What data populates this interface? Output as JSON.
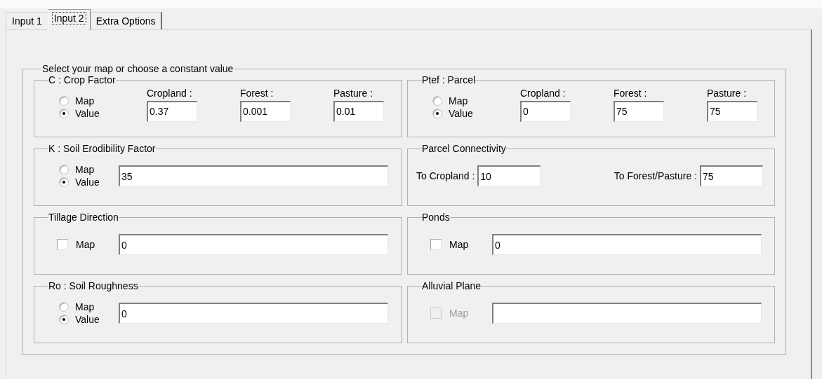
{
  "tabs": [
    {
      "label": "Input 1",
      "selected": false
    },
    {
      "label": "Input 2",
      "selected": true
    },
    {
      "label": "Extra Options",
      "selected": false
    }
  ],
  "outer_group": {
    "title": "Select your map or choose a constant value"
  },
  "groups": [
    {
      "title": "C : Crop Factor",
      "kind": "radio_fields",
      "options": [
        {
          "label": "Map",
          "selected": false
        },
        {
          "label": "Value",
          "selected": true
        }
      ],
      "fields": [
        {
          "label": "Cropland :",
          "value": "0.37"
        },
        {
          "label": "Forest :",
          "value": "0.001"
        },
        {
          "label": "Pasture :",
          "value": "0.01"
        }
      ]
    },
    {
      "title": "Ptef : Parcel",
      "kind": "radio_fields",
      "options": [
        {
          "label": "Map",
          "selected": false
        },
        {
          "label": "Value",
          "selected": true
        }
      ],
      "fields": [
        {
          "label": "Cropland :",
          "value": "0"
        },
        {
          "label": "Forest :",
          "value": "75"
        },
        {
          "label": "Pasture :",
          "value": "75"
        }
      ]
    },
    {
      "title": "K : Soil Erodibility Factor",
      "kind": "radio_single",
      "options": [
        {
          "label": "Map",
          "selected": false
        },
        {
          "label": "Value",
          "selected": true
        }
      ],
      "fields": [
        {
          "value": "35"
        }
      ]
    },
    {
      "title": "Parcel Connectivity",
      "kind": "inline_fields",
      "fields": [
        {
          "label": "To Cropland :",
          "value": "10"
        },
        {
          "label": "To Forest/Pasture :",
          "value": "75"
        }
      ]
    },
    {
      "title": "Tillage Direction",
      "kind": "check_single",
      "check": {
        "label": "Map",
        "checked": false,
        "disabled": false
      },
      "fields": [
        {
          "value": "0"
        }
      ]
    },
    {
      "title": "Ponds",
      "kind": "check_single",
      "check": {
        "label": "Map",
        "checked": false,
        "disabled": false
      },
      "fields": [
        {
          "value": "0"
        }
      ]
    },
    {
      "title": "Ro : Soil Roughness",
      "kind": "radio_single",
      "options": [
        {
          "label": "Map",
          "selected": false
        },
        {
          "label": "Value",
          "selected": true
        }
      ],
      "fields": [
        {
          "value": "0"
        }
      ]
    },
    {
      "title": "Alluvial Plane",
      "kind": "check_single",
      "check": {
        "label": "Map",
        "checked": false,
        "disabled": true
      }
    }
  ]
}
